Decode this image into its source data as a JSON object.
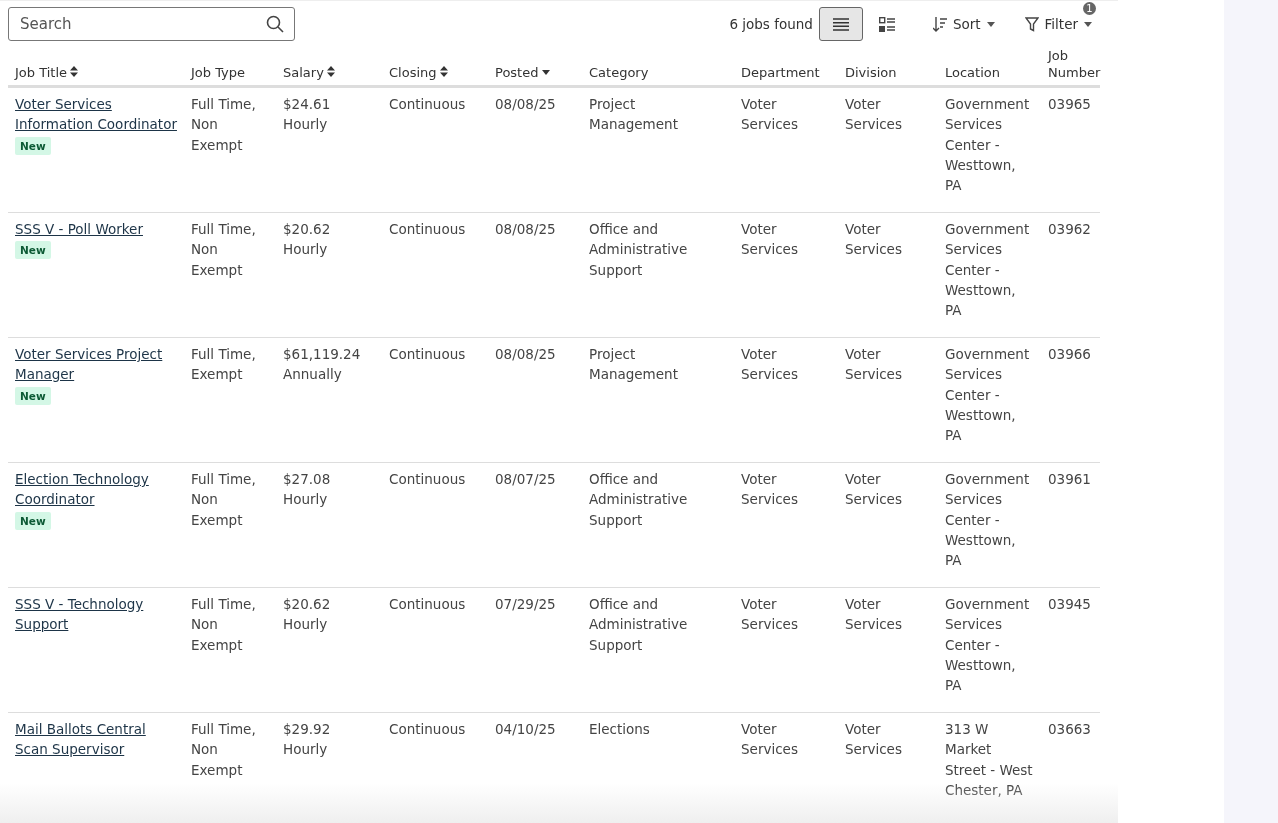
{
  "search": {
    "placeholder": "Search"
  },
  "results_count": "6 jobs found",
  "views": [
    {
      "kind": "list",
      "selected": true
    },
    {
      "kind": "grid",
      "selected": false
    }
  ],
  "sort": {
    "label": "Sort"
  },
  "filter": {
    "label": "Filter",
    "badge": "1"
  },
  "table": {
    "columns": [
      {
        "label": "Job Title",
        "kind": "sortable"
      },
      {
        "label": "Job Type",
        "kind": "plain"
      },
      {
        "label": "Salary",
        "kind": "sortable"
      },
      {
        "label": "Closing",
        "kind": "sortable"
      },
      {
        "label": "Posted",
        "kind": "sorted"
      },
      {
        "label": "Category",
        "kind": "plain"
      },
      {
        "label": "Department",
        "kind": "plain"
      },
      {
        "label": "Division",
        "kind": "plain"
      },
      {
        "label": "Location",
        "kind": "plain"
      },
      {
        "label": "Job Number",
        "kind": "plain"
      }
    ],
    "rows": [
      {
        "job_title": {
          "text": "Voter Services Information Coordinator",
          "badge": "New"
        },
        "job_type": "Full Time, Non Exempt",
        "salary": "$24.61 Hourly",
        "closing": "Continuous",
        "posted": "08/08/25",
        "category": "Project Management",
        "department": "Voter Services",
        "division": "Voter Services",
        "location": "Government Services Center - Westtown, PA",
        "job_number": "03965"
      },
      {
        "job_title": {
          "text": "SSS V - Poll Worker",
          "badge": "New"
        },
        "job_type": "Full Time, Non Exempt",
        "salary": "$20.62 Hourly",
        "closing": "Continuous",
        "posted": "08/08/25",
        "category": "Office and Administrative Support",
        "department": "Voter Services",
        "division": "Voter Services",
        "location": "Government Services Center - Westtown, PA",
        "job_number": "03962"
      },
      {
        "job_title": {
          "text": "Voter Services Project Manager",
          "badge": "New"
        },
        "job_type": "Full Time, Exempt",
        "salary": "$61,119.24 Annually",
        "closing": "Continuous",
        "posted": "08/08/25",
        "category": "Project Management",
        "department": "Voter Services",
        "division": "Voter Services",
        "location": "Government Services Center - Westtown, PA",
        "job_number": "03966"
      },
      {
        "job_title": {
          "text": "Election Technology Coordinator",
          "badge": "New"
        },
        "job_type": "Full Time, Non Exempt",
        "salary": "$27.08 Hourly",
        "closing": "Continuous",
        "posted": "08/07/25",
        "category": "Office and Administrative Support",
        "department": "Voter Services",
        "division": "Voter Services",
        "location": "Government Services Center - Westtown, PA",
        "job_number": "03961"
      },
      {
        "job_title": {
          "text": "SSS V - Technology Support"
        },
        "job_type": "Full Time, Non Exempt",
        "salary": "$20.62 Hourly",
        "closing": "Continuous",
        "posted": "07/29/25",
        "category": "Office and Administrative Support",
        "department": "Voter Services",
        "division": "Voter Services",
        "location": "Government Services Center - Westtown, PA",
        "job_number": "03945"
      },
      {
        "job_title": {
          "text": "Mail Ballots Central Scan Supervisor"
        },
        "job_type": "Full Time, Non Exempt",
        "salary": "$29.92 Hourly",
        "closing": "Continuous",
        "posted": "04/10/25",
        "category": "Elections",
        "department": "Voter Services",
        "division": "Voter Services",
        "location": "313 W Market Street - West Chester, PA",
        "job_number": "03663"
      }
    ]
  }
}
